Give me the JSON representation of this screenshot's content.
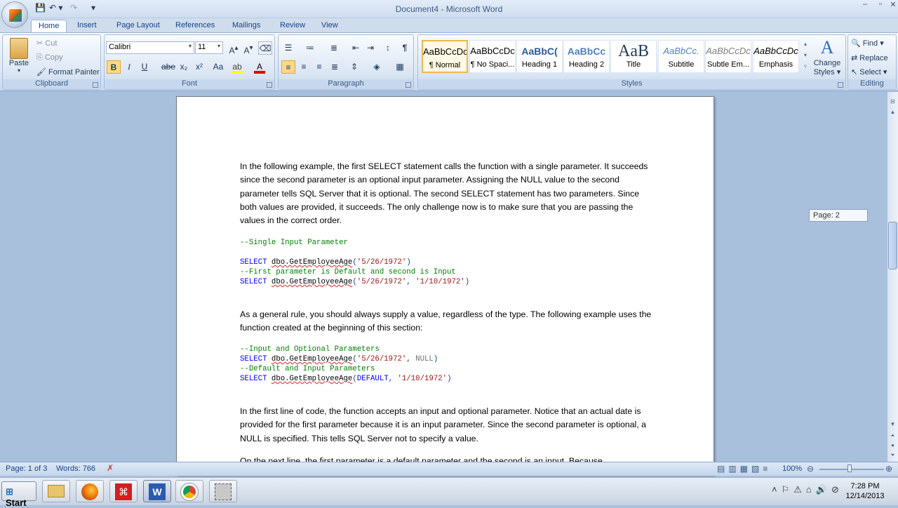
{
  "window": {
    "title": "Document4 - Microsoft Word"
  },
  "tabs": [
    "Home",
    "Insert",
    "Page Layout",
    "References",
    "Mailings",
    "Review",
    "View"
  ],
  "clipboard": {
    "paste": "Paste",
    "cut": "Cut",
    "copy": "Copy",
    "format_painter": "Format Painter",
    "label": "Clipboard"
  },
  "font": {
    "name": "Calibri",
    "size": "11",
    "label": "Font",
    "bold": "B",
    "italic": "I",
    "underline": "U",
    "strike": "abe",
    "subscript": "x₂",
    "superscript": "x²",
    "change_case": "Aa"
  },
  "paragraph": {
    "label": "Paragraph",
    "pilcrow": "¶"
  },
  "styles": {
    "label": "Styles",
    "items": [
      {
        "sample": "AaBbCcDc",
        "name": "¶ Normal"
      },
      {
        "sample": "AaBbCcDc",
        "name": "¶ No Spaci..."
      },
      {
        "sample": "AaBbC(",
        "name": "Heading 1"
      },
      {
        "sample": "AaBbCc",
        "name": "Heading 2"
      },
      {
        "sample": "AaB",
        "name": "Title"
      },
      {
        "sample": "AaBbCc.",
        "name": "Subtitle"
      },
      {
        "sample": "AaBbCcDc",
        "name": "Subtle Em..."
      },
      {
        "sample": "AaBbCcDc",
        "name": "Emphasis"
      }
    ],
    "change_styles_line1": "Change",
    "change_styles_line2": "Styles"
  },
  "editing": {
    "label": "Editing",
    "find": "Find",
    "replace": "Replace",
    "select": "Select"
  },
  "document": {
    "p1": "In the following example, the first SELECT statement calls the function with a single parameter. It succeeds since the second parameter is an optional input parameter. Assigning the NULL value to the second parameter tells SQL Server that it is optional. The second SELECT statement has two parameters. Since both values are provided, it succeeds. The only challenge now is to make sure that you are passing the values in the correct order.",
    "code1": {
      "comment1": "--Single Input Parameter",
      "select": "SELECT",
      "fn": "dbo.GetEmployeeAge",
      "arg1": "'5/26/1972'",
      "comment2": "--First parameter is Default and second is Input",
      "arg2": "'1/10/1972'"
    },
    "p2": "As a general rule, you should always supply a value, regardless of the type. The following example uses the function created at the beginning of this section:",
    "code2": {
      "comment1": "--Input and Optional Parameters",
      "null": "NULL",
      "comment2": "--Default and Input Parameters",
      "default": "DEFAULT"
    },
    "p3": "In the first line of code, the function accepts an input and optional parameter. Notice that an actual date is provided for the first parameter because it is an input parameter. Since the second parameter is optional, a NULL is specified. This tells SQL Server not to specify a value.",
    "p4_partial": "On the next line, the first parameter is a default parameter and the second is an input. Because"
  },
  "page_tooltip": "Page: 2",
  "status": {
    "page": "Page: 1 of 3",
    "words": "Words: 766",
    "zoom": "100%"
  },
  "taskbar": {
    "start": "Start",
    "time": "7:28 PM",
    "date": "12/14/2013"
  }
}
